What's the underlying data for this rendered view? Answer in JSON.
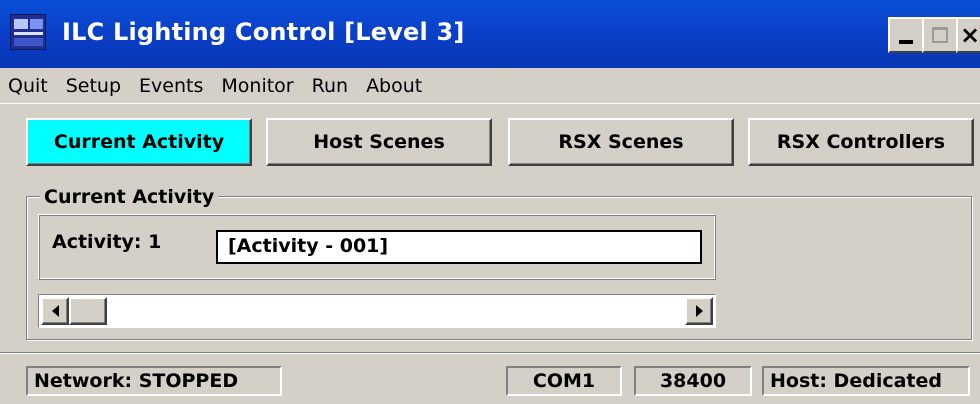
{
  "window": {
    "title": "ILC Lighting Control [Level 3]",
    "icon": "app-logo-icon",
    "controls": {
      "minimize": "_",
      "close": "×"
    }
  },
  "menu": {
    "items": [
      "Quit",
      "Setup",
      "Events",
      "Monitor",
      "Run",
      "About"
    ]
  },
  "tabs": [
    {
      "label": "Current Activity",
      "active": true,
      "color": "#00ffff"
    },
    {
      "label": "Host Scenes",
      "active": false
    },
    {
      "label": "RSX Scenes",
      "active": false
    },
    {
      "label": "RSX Controllers",
      "active": false
    }
  ],
  "current_activity": {
    "group_label": "Current Activity",
    "activity_label": "Activity: 1",
    "activity_value": "[Activity - 001]",
    "scroll_position": 0
  },
  "status": {
    "network": "Network: STOPPED",
    "port": "COM1",
    "baud": "38400",
    "host": "Host: Dedicated"
  }
}
